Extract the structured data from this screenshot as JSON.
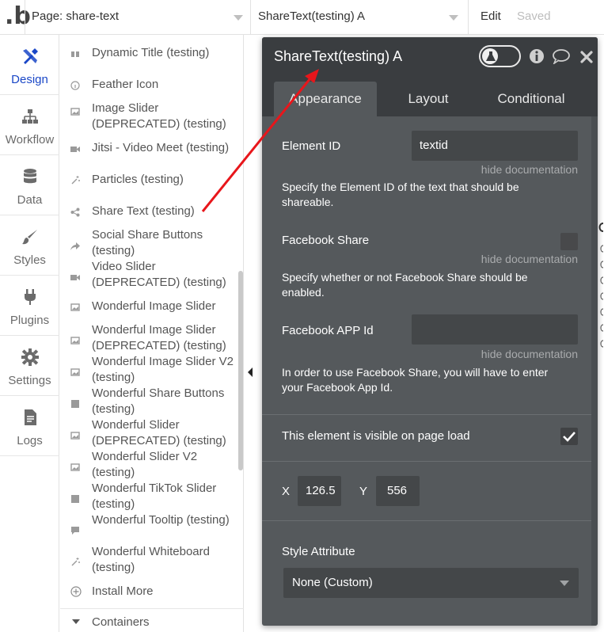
{
  "topbar": {
    "logo": ".b",
    "page_select_value": "Page: share-text",
    "element_select_value": "ShareText(testing) A",
    "edit_label": "Edit",
    "saved_label": "Saved"
  },
  "leftnav": {
    "items": [
      {
        "label": "Design",
        "icon": "design-icon",
        "active": true
      },
      {
        "label": "Workflow",
        "icon": "workflow-icon"
      },
      {
        "label": "Data",
        "icon": "database-icon"
      },
      {
        "label": "Styles",
        "icon": "brush-icon"
      },
      {
        "label": "Plugins",
        "icon": "plug-icon"
      },
      {
        "label": "Settings",
        "icon": "gear-icon"
      },
      {
        "label": "Logs",
        "icon": "document-icon"
      }
    ]
  },
  "element_list": {
    "items": [
      {
        "label": "Dynamic Title (testing)",
        "icon": "quote-icon"
      },
      {
        "label": "Feather Icon",
        "icon": "info-circle-icon"
      },
      {
        "label": "Image Slider (DEPRECATED) (testing)",
        "icon": "image-icon"
      },
      {
        "label": "Jitsi - Video Meet (testing)",
        "icon": "video-icon"
      },
      {
        "label": "Particles (testing)",
        "icon": "sparkle-icon"
      },
      {
        "label": "Share Text (testing)",
        "icon": "share-icon"
      },
      {
        "label": "Social Share Buttons (testing)",
        "icon": "forward-icon"
      },
      {
        "label": "Video Slider (DEPRECATED) (testing)",
        "icon": "video-icon"
      },
      {
        "label": "Wonderful Image Slider",
        "icon": "image-icon"
      },
      {
        "label": "Wonderful Image Slider (DEPRECATED) (testing)",
        "icon": "image-icon"
      },
      {
        "label": "Wonderful Image Slider V2 (testing)",
        "icon": "image-icon"
      },
      {
        "label": "Wonderful Share Buttons (testing)",
        "icon": "square-icon"
      },
      {
        "label": "Wonderful Slider (DEPRECATED) (testing)",
        "icon": "image-icon"
      },
      {
        "label": "Wonderful Slider V2 (testing)",
        "icon": "image-icon"
      },
      {
        "label": "Wonderful TikTok Slider (testing)",
        "icon": "square-icon"
      },
      {
        "label": "Wonderful Tooltip (testing)",
        "icon": "chat-icon"
      },
      {
        "label": "Wonderful Whiteboard (testing)",
        "icon": "sparkle-icon"
      }
    ],
    "install_more": "Install More",
    "containers": "Containers"
  },
  "panel": {
    "title": "ShareText(testing) A",
    "tabs": [
      "Appearance",
      "Layout",
      "Conditional"
    ],
    "active_tab": "Appearance",
    "element_id_label": "Element ID",
    "element_id_value": "textid",
    "hide_doc": "hide documentation",
    "element_id_doc": "Specify the Element ID of the text that should be shareable.",
    "facebook_share_label": "Facebook Share",
    "facebook_share_doc": "Specify whether or not Facebook Share should be enabled.",
    "facebook_app_label": "Facebook APP Id",
    "facebook_app_value": "",
    "facebook_app_doc": "In order to use Facebook Share, you will have to enter your Facebook App Id.",
    "visible_label": "This element is visible on page load",
    "visible_checked": true,
    "x_label": "X",
    "x_value": "126.5",
    "y_label": "Y",
    "y_value": "556",
    "style_label": "Style Attribute",
    "style_value": "None (Custom)"
  },
  "colors": {
    "panel_bg": "#55595c",
    "panel_header": "#3a3d40",
    "active_nav": "#1a47c7",
    "arrow": "#e8161b"
  }
}
